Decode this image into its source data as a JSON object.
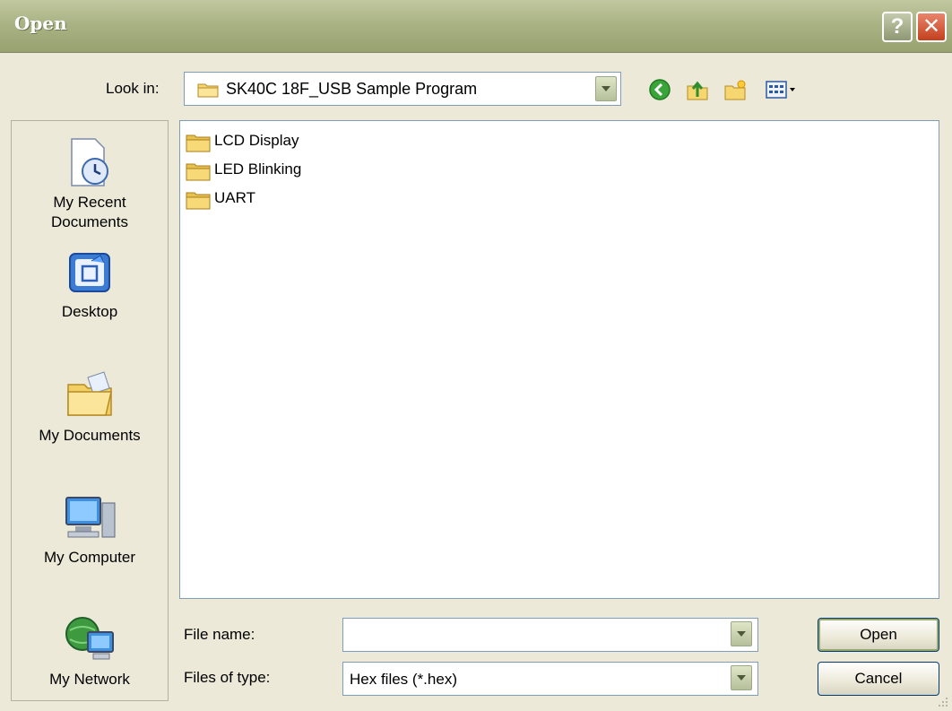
{
  "window": {
    "title": "Open",
    "help_label": "?",
    "close_label": "✕"
  },
  "look_in": {
    "label": "Look in:",
    "value": "SK40C 18F_USB Sample Program"
  },
  "toolbar": {
    "icons": [
      "back-icon",
      "up-folder-icon",
      "new-folder-icon",
      "view-menu-icon"
    ]
  },
  "places": [
    {
      "label_line1": "My Recent",
      "label_line2": "Documents",
      "icon": "recent-documents-icon"
    },
    {
      "label_line1": "Desktop",
      "label_line2": "",
      "icon": "desktop-icon"
    },
    {
      "label_line1": "My Documents",
      "label_line2": "",
      "icon": "my-documents-icon"
    },
    {
      "label_line1": "My Computer",
      "label_line2": "",
      "icon": "my-computer-icon"
    },
    {
      "label_line1": "My Network",
      "label_line2": "",
      "icon": "my-network-icon"
    }
  ],
  "files": [
    {
      "name": "LCD Display",
      "icon": "folder-icon"
    },
    {
      "name": "LED Blinking",
      "icon": "folder-icon"
    },
    {
      "name": "UART",
      "icon": "folder-icon"
    }
  ],
  "file_name": {
    "label": "File name:",
    "value": ""
  },
  "file_type": {
    "label": "Files of type:",
    "value": "Hex files (*.hex)"
  },
  "buttons": {
    "open": "Open",
    "cancel": "Cancel"
  },
  "colors": {
    "titlebar": "#a9b384",
    "close": "#c3401e",
    "border_blue": "#7f9db9"
  }
}
